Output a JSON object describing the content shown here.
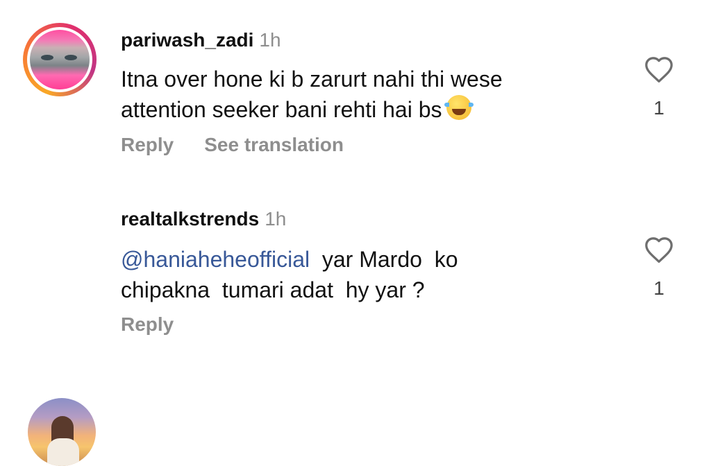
{
  "comments": [
    {
      "username": "pariwash_zadi",
      "time": "1h",
      "text_line1": "Itna over hone ki b zarurt nahi thi wese",
      "text_line2": "attention seeker bani rehti hai bs",
      "emoji": "face-with-tears-of-joy",
      "reply_label": "Reply",
      "translation_label": "See translation",
      "likes": "1",
      "story_ring": true
    },
    {
      "username": "realtalkstrends",
      "time": "1h",
      "mention": "@haniaheheofficial",
      "text_line1_rest": "  yar Mardo  ko",
      "text_line2": "chipakna  tumari adat  hy yar ?",
      "reply_label": "Reply",
      "likes": "1",
      "story_ring": false
    }
  ],
  "colors": {
    "mention": "#385898",
    "secondary_text": "#8e8e8e",
    "primary_text": "#111111"
  }
}
